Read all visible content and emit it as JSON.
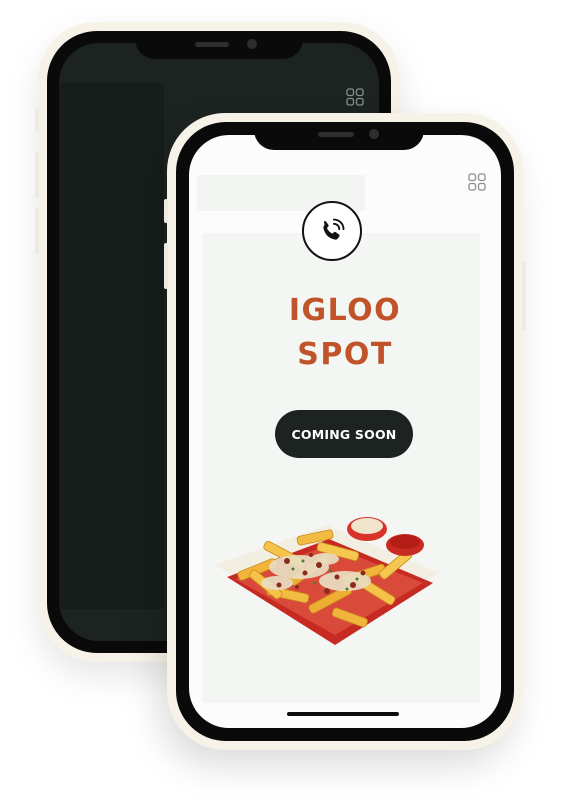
{
  "back_phone": {
    "menu_icon": "grid-icon",
    "screen_color": "#1c2320"
  },
  "front_phone": {
    "menu_icon": "grid-icon",
    "call_icon": "phone-call-icon",
    "brand": {
      "line1": "IGLOO",
      "line2": "SPOT",
      "color": "#c0532a"
    },
    "cta_label": "COMING SOON",
    "cta_color": "#1d2321",
    "hero_image": "loaded-fries-tray-with-sauces"
  }
}
